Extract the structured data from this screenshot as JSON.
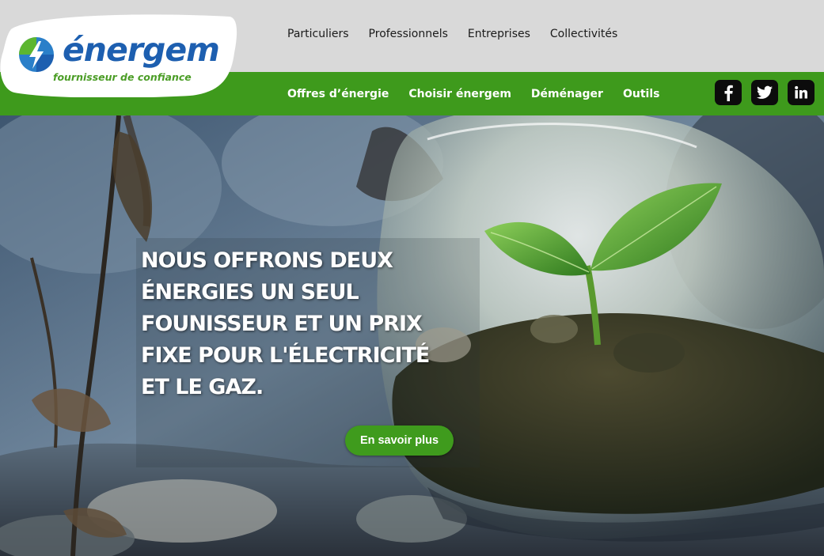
{
  "logo": {
    "name": "énergem",
    "tagline": "fournisseur de confiance"
  },
  "top_nav": [
    {
      "label": "Particuliers"
    },
    {
      "label": "Professionnels"
    },
    {
      "label": "Entreprises"
    },
    {
      "label": "Collectivités"
    }
  ],
  "main_nav": [
    {
      "label": "Offres d’énergie"
    },
    {
      "label": "Choisir énergem"
    },
    {
      "label": "Déménager"
    },
    {
      "label": "Outils"
    }
  ],
  "social": [
    {
      "icon": "facebook-icon"
    },
    {
      "icon": "twitter-icon"
    },
    {
      "icon": "linkedin-icon"
    }
  ],
  "hero": {
    "lines": [
      "NOUS OFFRONS DEUX",
      "ÉNERGIES UN SEUL",
      "FOUNISSEUR ET UN PRIX",
      "FIXE POUR L'ÉLECTRICITÉ",
      "ET LE GAZ."
    ],
    "cta_label": "En savoir plus"
  },
  "colors": {
    "brand_green": "#3e9a1c",
    "brand_blue": "#1d5fb0",
    "topbar_gray": "#d9d9d9"
  }
}
